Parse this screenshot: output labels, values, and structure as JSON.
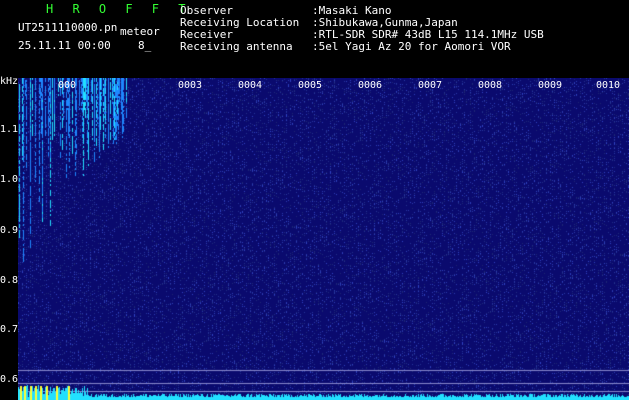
{
  "header": {
    "app_title": "H R O F F T",
    "filename": "UT2511110000.pn",
    "tag": "meteor",
    "datetime": "25.11.11 00:00",
    "count": "8_",
    "info": [
      {
        "label": "Observer",
        "value": ":Masaki Kano"
      },
      {
        "label": "Receiving Location",
        "value": ":Shibukawa,Gunma,Japan"
      },
      {
        "label": "Receiver",
        "value": ":RTL-SDR SDR# 43dB L15 114.1MHz USB"
      },
      {
        "label": "Receiving antenna",
        "value": ":5el Yagi Az 20 for Aomori VOR"
      }
    ]
  },
  "axis": {
    "unit": "kHz",
    "y_ticks": [
      "1.1",
      "1.0",
      "0.9",
      "0.8",
      "0.7",
      "0.6"
    ],
    "x_labels": [
      "000",
      "0003",
      "0004",
      "0005",
      "0006",
      "0007",
      "0008",
      "0009",
      "0010"
    ]
  },
  "colors": {
    "background": "#0a0a6e",
    "header_green": "#33ff33",
    "signal": "#22e0ff"
  }
}
